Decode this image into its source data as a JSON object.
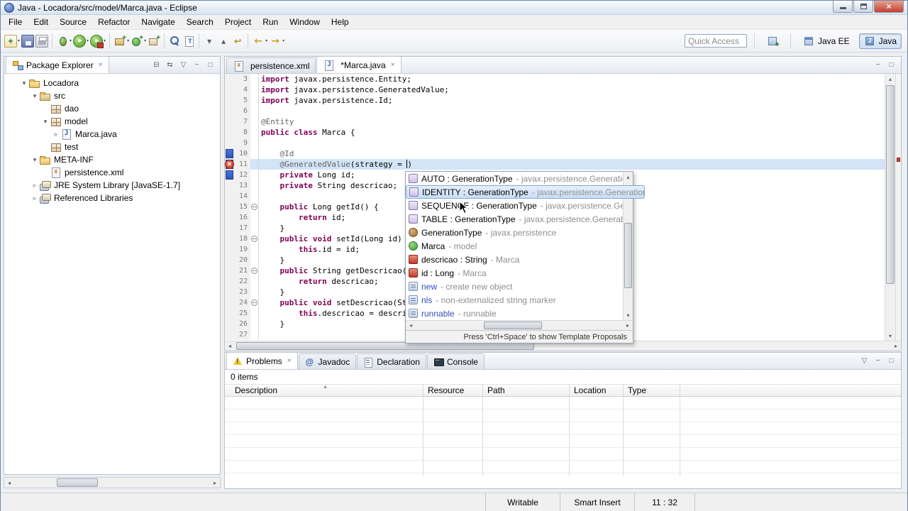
{
  "window": {
    "title": "Java - Locadora/src/model/Marca.java - Eclipse",
    "controls": [
      "minimize",
      "maximize",
      "close"
    ]
  },
  "menu": {
    "items": [
      "File",
      "Edit",
      "Source",
      "Refactor",
      "Navigate",
      "Search",
      "Project",
      "Run",
      "Window",
      "Help"
    ]
  },
  "toolbar": {
    "quick_access_placeholder": "Quick Access",
    "perspective_java_ee": "Java EE",
    "perspective_java": "Java",
    "groups": [
      [
        {
          "name": "new-wizard-icon",
          "dropdown": true
        },
        {
          "name": "save-icon"
        },
        {
          "name": "print-icon"
        }
      ],
      [
        {
          "name": "debug-icon",
          "dropdown": true
        },
        {
          "name": "run-icon",
          "dropdown": true
        },
        {
          "name": "run-external-icon",
          "dropdown": true
        }
      ],
      [
        {
          "name": "new-java-project-icon",
          "dropdown": true
        },
        {
          "name": "new-java-class-icon",
          "dropdown": true
        },
        {
          "name": "new-java-package-icon"
        }
      ],
      [
        {
          "name": "search-icon"
        },
        {
          "name": "open-type-icon"
        }
      ],
      [
        {
          "name": "next-annotation-icon"
        },
        {
          "name": "previous-annotation-icon"
        },
        {
          "name": "last-edit-location-icon"
        }
      ],
      [
        {
          "name": "back-icon",
          "dropdown": true
        },
        {
          "name": "forward-icon",
          "dropdown": true
        }
      ]
    ]
  },
  "explorer": {
    "tab_title": "Package Explorer",
    "tools": [
      "collapse-all-icon",
      "link-editor-icon",
      "view-menu-icon",
      "minimize-icon",
      "maximize-icon"
    ],
    "tree": [
      {
        "label": "Locadora",
        "indent": 0,
        "icon": "project",
        "expand": "open"
      },
      {
        "label": "src",
        "indent": 1,
        "icon": "src-folder",
        "expand": "open"
      },
      {
        "label": "dao",
        "indent": 2,
        "icon": "package",
        "expand": "none"
      },
      {
        "label": "model",
        "indent": 2,
        "icon": "package",
        "expand": "open"
      },
      {
        "label": "Marca.java",
        "indent": 3,
        "icon": "java-file",
        "expand": "closed"
      },
      {
        "label": "test",
        "indent": 2,
        "icon": "package",
        "expand": "none"
      },
      {
        "label": "META-INF",
        "indent": 1,
        "icon": "folder",
        "expand": "open"
      },
      {
        "label": "persistence.xml",
        "indent": 2,
        "icon": "xml-file",
        "expand": "none"
      },
      {
        "label": "JRE System Library [JavaSE-1.7]",
        "indent": 1,
        "icon": "library",
        "expand": "closed"
      },
      {
        "label": "Referenced Libraries",
        "indent": 1,
        "icon": "library",
        "expand": "closed"
      }
    ]
  },
  "editor": {
    "tabs": [
      {
        "label": "persistence.xml",
        "icon": "xml-file",
        "active": false
      },
      {
        "label": "*Marca.java",
        "icon": "java-file",
        "active": true
      }
    ],
    "tools": [
      "minimize-icon",
      "maximize-icon"
    ],
    "current_line": 11,
    "error_line": 11,
    "changed_lines": [
      10,
      11,
      12
    ],
    "lines": [
      {
        "n": 3,
        "seg": [
          [
            "k",
            "import"
          ],
          [
            "p",
            " javax.persistence.Entity;"
          ]
        ]
      },
      {
        "n": 4,
        "seg": [
          [
            "k",
            "import"
          ],
          [
            "p",
            " javax.persistence.GeneratedValue;"
          ]
        ]
      },
      {
        "n": 5,
        "seg": [
          [
            "k",
            "import"
          ],
          [
            "p",
            " javax.persistence.Id;"
          ]
        ]
      },
      {
        "n": 6,
        "seg": []
      },
      {
        "n": 7,
        "seg": [
          [
            "a",
            "@Entity"
          ]
        ]
      },
      {
        "n": 8,
        "seg": [
          [
            "k",
            "public"
          ],
          [
            "p",
            " "
          ],
          [
            "k",
            "class"
          ],
          [
            "p",
            " Marca {"
          ]
        ]
      },
      {
        "n": 9,
        "seg": []
      },
      {
        "n": 10,
        "seg": [
          [
            "p",
            "    "
          ],
          [
            "a",
            "@Id"
          ]
        ]
      },
      {
        "n": 11,
        "seg": [
          [
            "p",
            "    "
          ],
          [
            "a",
            "@GeneratedValue"
          ],
          [
            "p",
            "(strategy = "
          ],
          [
            "caret",
            ""
          ],
          [
            "p",
            ")"
          ]
        ]
      },
      {
        "n": 12,
        "seg": [
          [
            "p",
            "    "
          ],
          [
            "k",
            "private"
          ],
          [
            "p",
            " Long id;"
          ]
        ]
      },
      {
        "n": 13,
        "seg": [
          [
            "p",
            "    "
          ],
          [
            "k",
            "private"
          ],
          [
            "p",
            " String descricao;"
          ]
        ]
      },
      {
        "n": 14,
        "seg": []
      },
      {
        "n": 15,
        "fold": true,
        "seg": [
          [
            "p",
            "    "
          ],
          [
            "k",
            "public"
          ],
          [
            "p",
            " Long getId() {"
          ]
        ]
      },
      {
        "n": 16,
        "seg": [
          [
            "p",
            "        "
          ],
          [
            "k",
            "return"
          ],
          [
            "p",
            " id;"
          ]
        ]
      },
      {
        "n": 17,
        "seg": [
          [
            "p",
            "    }"
          ]
        ]
      },
      {
        "n": 18,
        "fold": true,
        "seg": [
          [
            "p",
            "    "
          ],
          [
            "k",
            "public"
          ],
          [
            "p",
            " "
          ],
          [
            "k",
            "void"
          ],
          [
            "p",
            " setId(Long id) {"
          ]
        ]
      },
      {
        "n": 19,
        "seg": [
          [
            "p",
            "        "
          ],
          [
            "k",
            "this"
          ],
          [
            "p",
            ".id = id;"
          ]
        ]
      },
      {
        "n": 20,
        "seg": [
          [
            "p",
            "    }"
          ]
        ]
      },
      {
        "n": 21,
        "fold": true,
        "seg": [
          [
            "p",
            "    "
          ],
          [
            "k",
            "public"
          ],
          [
            "p",
            " String getDescricao() {"
          ]
        ]
      },
      {
        "n": 22,
        "seg": [
          [
            "p",
            "        "
          ],
          [
            "k",
            "return"
          ],
          [
            "p",
            " descricao;"
          ]
        ]
      },
      {
        "n": 23,
        "seg": [
          [
            "p",
            "    }"
          ]
        ]
      },
      {
        "n": 24,
        "fold": true,
        "seg": [
          [
            "p",
            "    "
          ],
          [
            "k",
            "public"
          ],
          [
            "p",
            " "
          ],
          [
            "k",
            "void"
          ],
          [
            "p",
            " setDescricao(String descricao) {"
          ]
        ]
      },
      {
        "n": 25,
        "seg": [
          [
            "p",
            "        "
          ],
          [
            "k",
            "this"
          ],
          [
            "p",
            ".descricao = descricao;"
          ]
        ]
      },
      {
        "n": 26,
        "seg": [
          [
            "p",
            "    }"
          ]
        ]
      },
      {
        "n": 27,
        "seg": []
      }
    ]
  },
  "assist": {
    "items": [
      {
        "icon": "enum-constant",
        "name": "AUTO : GenerationType",
        "qualifier": " - javax.persistence.GenerationType",
        "selected": false
      },
      {
        "icon": "enum-constant",
        "name": "IDENTITY : GenerationType",
        "qualifier": " - javax.persistence.GenerationType",
        "selected": true
      },
      {
        "icon": "enum-constant",
        "name": "SEQUENCE : GenerationType",
        "qualifier": " - javax.persistence.GenerationType",
        "selected": false
      },
      {
        "icon": "enum-constant",
        "name": "TABLE : GenerationType",
        "qualifier": " - javax.persistence.GenerationType",
        "selected": false
      },
      {
        "icon": "enum",
        "name": "GenerationType",
        "qualifier": " - javax.persistence",
        "selected": false
      },
      {
        "icon": "class",
        "name": "Marca",
        "qualifier": " - model",
        "selected": false
      },
      {
        "icon": "field-private",
        "name": "descricao : String",
        "qualifier": " - Marca",
        "selected": false
      },
      {
        "icon": "field-private",
        "name": "id : Long",
        "qualifier": " - Marca",
        "selected": false
      },
      {
        "icon": "template",
        "name": "new",
        "qualifier": " - create new object",
        "selected": false
      },
      {
        "icon": "template",
        "name": "nls",
        "qualifier": " - non-externalized string marker",
        "selected": false
      },
      {
        "icon": "template",
        "name": "runnable",
        "qualifier": " - runnable",
        "selected": false
      }
    ],
    "footer": "Press 'Ctrl+Space' to show Template Proposals"
  },
  "problems": {
    "tabs": [
      {
        "label": "Problems",
        "icon": "problems",
        "active": true
      },
      {
        "label": "Javadoc",
        "icon": "javadoc",
        "active": false
      },
      {
        "label": "Declaration",
        "icon": "declaration",
        "active": false
      },
      {
        "label": "Console",
        "icon": "console",
        "active": false
      }
    ],
    "tools": [
      "view-menu-icon",
      "minimize-icon",
      "maximize-icon"
    ],
    "items_count": "0 items",
    "columns": [
      "Description",
      "Resource",
      "Path",
      "Location",
      "Type"
    ]
  },
  "statusbar": {
    "writable": "Writable",
    "insert_mode": "Smart Insert",
    "position": "11 : 32"
  },
  "colors": {
    "keyword": "#7f0055",
    "annotation_gray": "#646464",
    "qualifier_gray": "#8e8e8e",
    "selection_bg": "#c8dff7",
    "current_line_bg": "#d2e4f6",
    "error_red": "#c22f1c",
    "quickdiff_blue": "#2c55b8"
  }
}
